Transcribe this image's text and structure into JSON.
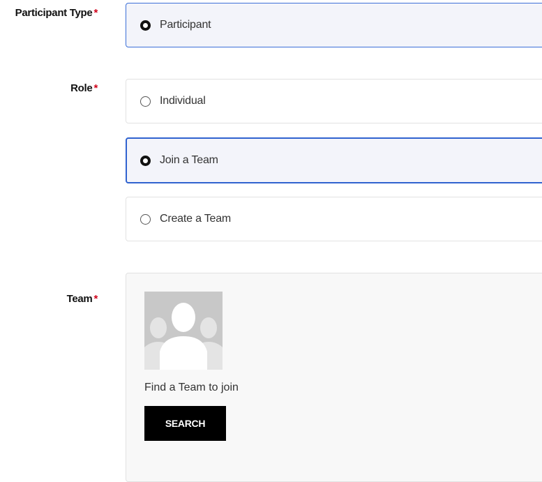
{
  "participant_type": {
    "label": "Participant Type",
    "required_mark": "*",
    "options": [
      {
        "label": "Participant",
        "selected": true
      }
    ]
  },
  "role": {
    "label": "Role",
    "required_mark": "*",
    "options": [
      {
        "label": "Individual",
        "selected": false
      },
      {
        "label": "Join a Team",
        "selected": true
      },
      {
        "label": "Create a Team",
        "selected": false
      }
    ]
  },
  "team": {
    "label": "Team",
    "required_mark": "*",
    "prompt": "Find a Team to join",
    "search_label": "SEARCH",
    "avatar_icon": "team-placeholder-icon"
  },
  "colors": {
    "required": "#d0021b",
    "selected_border": "#3b6fd8",
    "selected_bg": "#f3f4fa",
    "button_bg": "#000000"
  }
}
